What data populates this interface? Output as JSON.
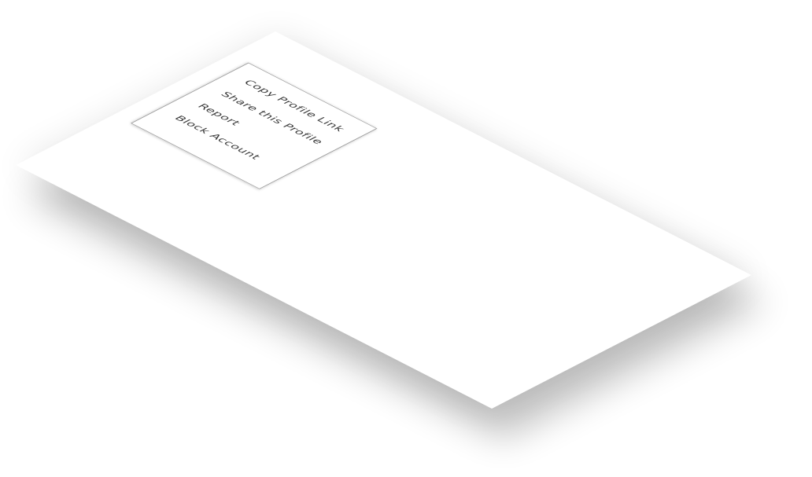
{
  "context_menu": {
    "items": [
      {
        "label": "Copy Profile Link"
      },
      {
        "label": "Share this Profile"
      },
      {
        "label": "Report"
      },
      {
        "label": "Block Account"
      }
    ]
  },
  "colors": {
    "background": "#ffffff",
    "menu_border": "#9a9a9a",
    "menu_text": "#3a3a3a"
  }
}
